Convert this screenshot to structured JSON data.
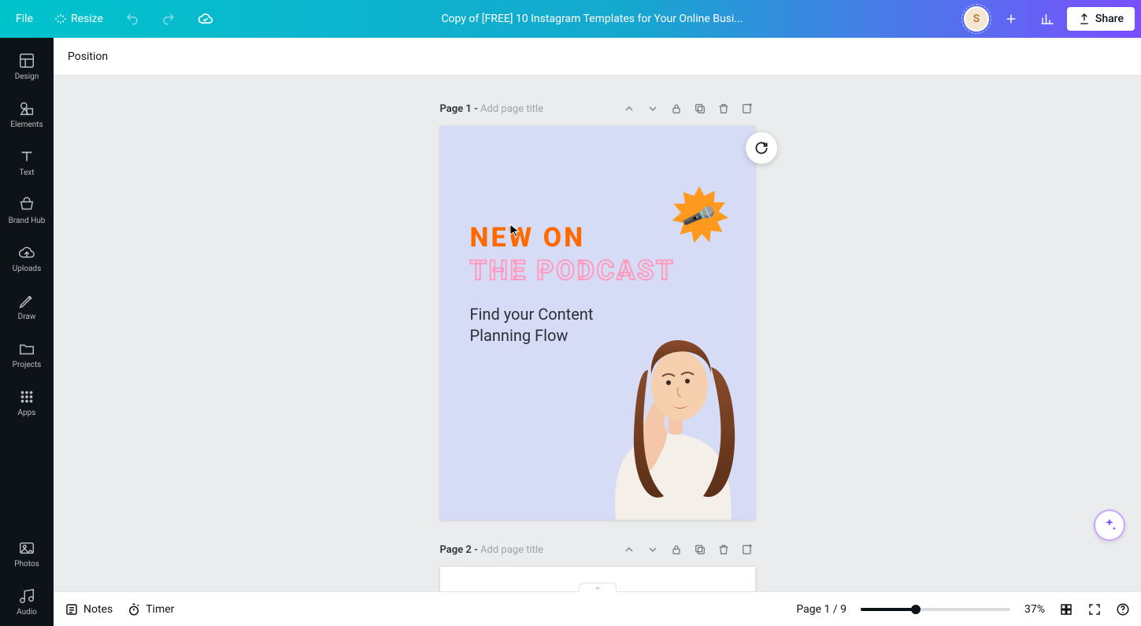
{
  "header": {
    "file_label": "File",
    "resize_label": "Resize",
    "document_title": "Copy of [FREE] 10 Instagram Templates for Your Online Busi...",
    "share_label": "Share",
    "avatar_initial": "S"
  },
  "sidebar": {
    "items": [
      {
        "id": "design",
        "label": "Design"
      },
      {
        "id": "elements",
        "label": "Elements"
      },
      {
        "id": "text",
        "label": "Text"
      },
      {
        "id": "brandhub",
        "label": "Brand Hub"
      },
      {
        "id": "uploads",
        "label": "Uploads"
      },
      {
        "id": "draw",
        "label": "Draw"
      },
      {
        "id": "projects",
        "label": "Projects"
      },
      {
        "id": "apps",
        "label": "Apps"
      }
    ],
    "extra": [
      {
        "id": "photos",
        "label": "Photos"
      },
      {
        "id": "audio",
        "label": "Audio"
      }
    ]
  },
  "toolbar": {
    "position_label": "Position"
  },
  "pages": {
    "p1": {
      "label": "Page 1 - ",
      "hint": "Add page title",
      "text_new_on": "NEW ON",
      "text_podcast": "THE PODCAST",
      "text_sub": "Find your Content Planning Flow"
    },
    "p2": {
      "label": "Page 2 - ",
      "hint": "Add page title"
    }
  },
  "footer": {
    "notes_label": "Notes",
    "timer_label": "Timer",
    "page_indicator": "Page 1 / 9",
    "zoom_percent": "37%",
    "zoom_value": 37
  },
  "colors": {
    "accent_orange": "#ff6a00",
    "accent_pink": "#ff9bbf",
    "canvas_bg": "#d6dcf6"
  }
}
